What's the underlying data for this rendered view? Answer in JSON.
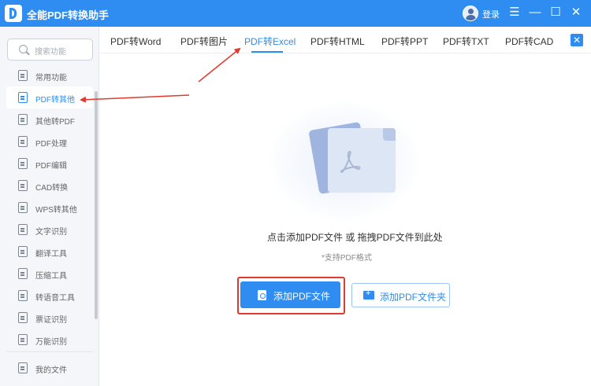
{
  "app": {
    "title": "全能PDF转换助手",
    "login_label": "登录"
  },
  "window_controls": {
    "menu": "☰",
    "minimize": "—",
    "maximize": "☐",
    "close": "✕"
  },
  "sidebar": {
    "search_placeholder": "搜索功能",
    "items": [
      {
        "label": "常用功能"
      },
      {
        "label": "PDF转其他",
        "active": true
      },
      {
        "label": "其他转PDF"
      },
      {
        "label": "PDF处理"
      },
      {
        "label": "PDF编辑"
      },
      {
        "label": "CAD转换"
      },
      {
        "label": "WPS转其他"
      },
      {
        "label": "文字识别"
      },
      {
        "label": "翻译工具"
      },
      {
        "label": "压缩工具"
      },
      {
        "label": "转语音工具"
      },
      {
        "label": "票证识别"
      },
      {
        "label": "万能识别"
      }
    ],
    "footer_item": "我的文件"
  },
  "tabs": [
    {
      "label": "PDF转Word"
    },
    {
      "label": "PDF转图片"
    },
    {
      "label": "PDF转Excel",
      "active": true
    },
    {
      "label": "PDF转HTML"
    },
    {
      "label": "PDF转PPT"
    },
    {
      "label": "PDF转TXT"
    },
    {
      "label": "PDF转CAD"
    }
  ],
  "tab_close": "✕",
  "main": {
    "drop_text": "点击添加PDF文件 或 拖拽PDF文件到此处",
    "support_text": "*支持PDF格式",
    "add_file_button": "添加PDF文件",
    "add_folder_button": "添加PDF文件夹"
  },
  "colors": {
    "accent": "#2f8cf0",
    "annotation_red": "#e03a2f"
  }
}
